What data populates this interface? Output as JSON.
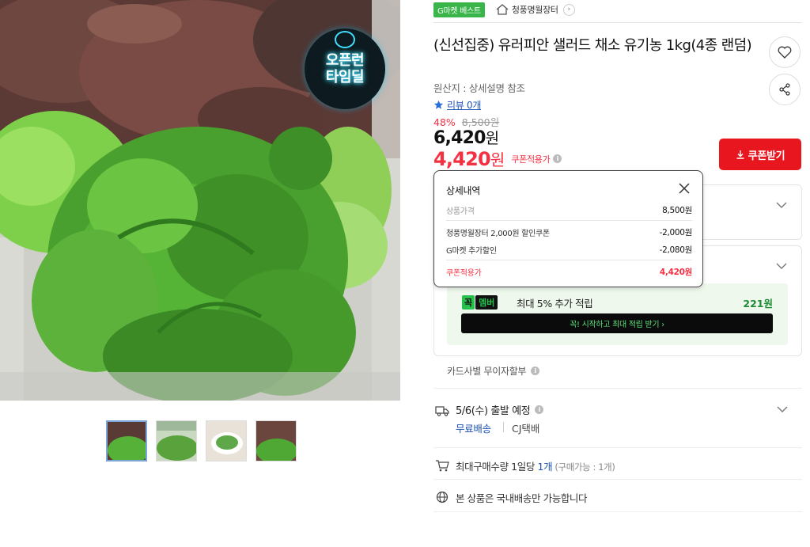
{
  "gallery": {
    "badge_line1": "오픈런",
    "badge_line2": "타임딜",
    "thumb_count": 4
  },
  "topbar": {
    "badge": "G마켓 베스트",
    "store_name": "청풍명월장터",
    "store_arrow": "›"
  },
  "product": {
    "title": "(신선집중) 유러피안 샐러드 채소 유기농 1kg(4종 랜덤)",
    "origin": "원산지 : 상세설명 참조",
    "review": "리뷰 0개",
    "discount_rate": "48%",
    "original_price": "8,500원",
    "sale_price": "6,420",
    "sale_unit": "원",
    "coupon_price": "4,420",
    "coupon_unit": "원",
    "coupon_tag": "쿠폰적용가",
    "coupon_button": "쿠폰받기"
  },
  "popup": {
    "title": "상세내역",
    "rows": [
      {
        "label": "상품가격",
        "value": "8,500원"
      },
      {
        "label": "청풍명월장터 2,000원 할인쿠폰",
        "value": "-2,000원"
      },
      {
        "label": "G마켓 추가할인",
        "value": "-2,080원"
      },
      {
        "label": "쿠폰적용가",
        "value": "4,420원"
      }
    ]
  },
  "club": {
    "logo_k": "꼭",
    "logo_m": "멤버",
    "text": "최대 5% 추가 적립",
    "amount": "221원",
    "button": "꼭! 시작하고 최대 적립 받기  ›"
  },
  "card": {
    "installment": "카드사별 무이자할부"
  },
  "shipping": {
    "date": "5/6(수) 출발 예정",
    "fee": "무료배송",
    "carrier": "CJ택배"
  },
  "purchase": {
    "max_qty_prefix": "최대구매수량 1일당 ",
    "max_qty_value": "1개",
    "max_qty_note": " (구매가능 : 1개)",
    "domestic": "본 상품은 국내배송만 가능합니다"
  },
  "colors": {
    "accent_red": "#f43142",
    "coupon_button": "#e8161f",
    "gmarket_green": "#39b54a",
    "link_blue": "#1d52b8"
  },
  "icons": {
    "home": "home-icon",
    "heart": "heart-icon",
    "share": "share-icon",
    "star": "star-icon",
    "download": "download-icon",
    "close": "close-icon",
    "truck": "truck-icon",
    "cart": "cart-icon",
    "globe": "globe-icon",
    "info": "info-icon",
    "chevron": "chevron-down-icon"
  }
}
